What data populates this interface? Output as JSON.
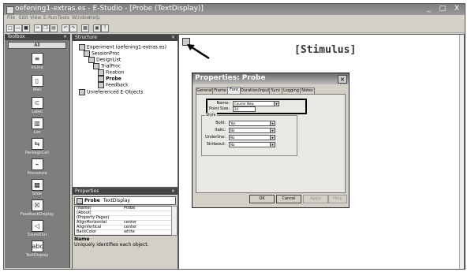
{
  "app": {
    "title": "oefening1-extras.es - E-Studio - [Probe  (TextDisplay)]",
    "window_controls": "_ □ X"
  },
  "menu": [
    "File",
    "Edit",
    "View",
    "E-Run",
    "Tools",
    "Window",
    "Help"
  ],
  "toolbar_icons": [
    "new-icon",
    "open-icon",
    "save-icon",
    "cut-icon",
    "copy-icon",
    "paste-icon",
    "undo-icon",
    "redo-icon",
    "properties-icon",
    "browser-icon",
    "help-icon"
  ],
  "toolbox": {
    "title": "Toolbox",
    "all_button": "All",
    "items": [
      {
        "label": "InLine",
        "icon": "inline-icon"
      },
      {
        "label": "Wait",
        "icon": "wait-icon"
      },
      {
        "label": "Label",
        "icon": "label-icon"
      },
      {
        "label": "List",
        "icon": "list-icon"
      },
      {
        "label": "PackageCall",
        "icon": "package-call-icon"
      },
      {
        "label": "Procedure",
        "icon": "procedure-icon"
      },
      {
        "label": "Slide",
        "icon": "slide-icon"
      },
      {
        "label": "FeedbackDisplay",
        "icon": "feedback-display-icon"
      },
      {
        "label": "SoundOut",
        "icon": "sound-out-icon"
      },
      {
        "label": "TextDisplay",
        "icon": "text-display-icon"
      }
    ]
  },
  "structure": {
    "title": "Structure",
    "tree": [
      {
        "label": "Experiment (oefening1-extras.es)"
      },
      {
        "label": "SessionProc"
      },
      {
        "label": "DesignList"
      },
      {
        "label": "TrialProc"
      },
      {
        "label": "Fixation"
      },
      {
        "label": "Probe"
      },
      {
        "label": "Feedback"
      },
      {
        "label": "Unreferenced E-Objects"
      }
    ]
  },
  "properties_pane": {
    "title": "Properties",
    "object_name": "Probe",
    "object_type": "TextDisplay",
    "rows": [
      {
        "name": "(Name)",
        "value": "Probe"
      },
      {
        "name": "(About)",
        "value": ""
      },
      {
        "name": "(Property Pages)",
        "value": ""
      },
      {
        "name": "AlignHorizontal",
        "value": "center"
      },
      {
        "name": "AlignVertical",
        "value": "center"
      },
      {
        "name": "BackColor",
        "value": "white"
      }
    ],
    "desc_title": "Name",
    "desc_text": "Uniquely identifies each object."
  },
  "workspace": {
    "stimulus_text": "[Stimulus]"
  },
  "dialog": {
    "title": "Properties: Probe",
    "tabs": [
      "General",
      "Frame",
      "Font",
      "Duration/Input",
      "Sync",
      "Logging",
      "Notes"
    ],
    "active_tab": "Font",
    "name_label": "Name:",
    "name_value": "Courier New",
    "point_size_label": "Point Size:",
    "point_size_value": "24",
    "style_caption": "Style",
    "bold_label": "Bold:",
    "bold_value": "Yes",
    "italic_label": "Italic:",
    "italic_value": "No",
    "underline_label": "Underline:",
    "underline_value": "No",
    "strikeout_label": "Strikeout:",
    "strikeout_value": "No",
    "ok": "OK",
    "cancel": "Cancel",
    "apply": "Apply",
    "help": "Help"
  }
}
